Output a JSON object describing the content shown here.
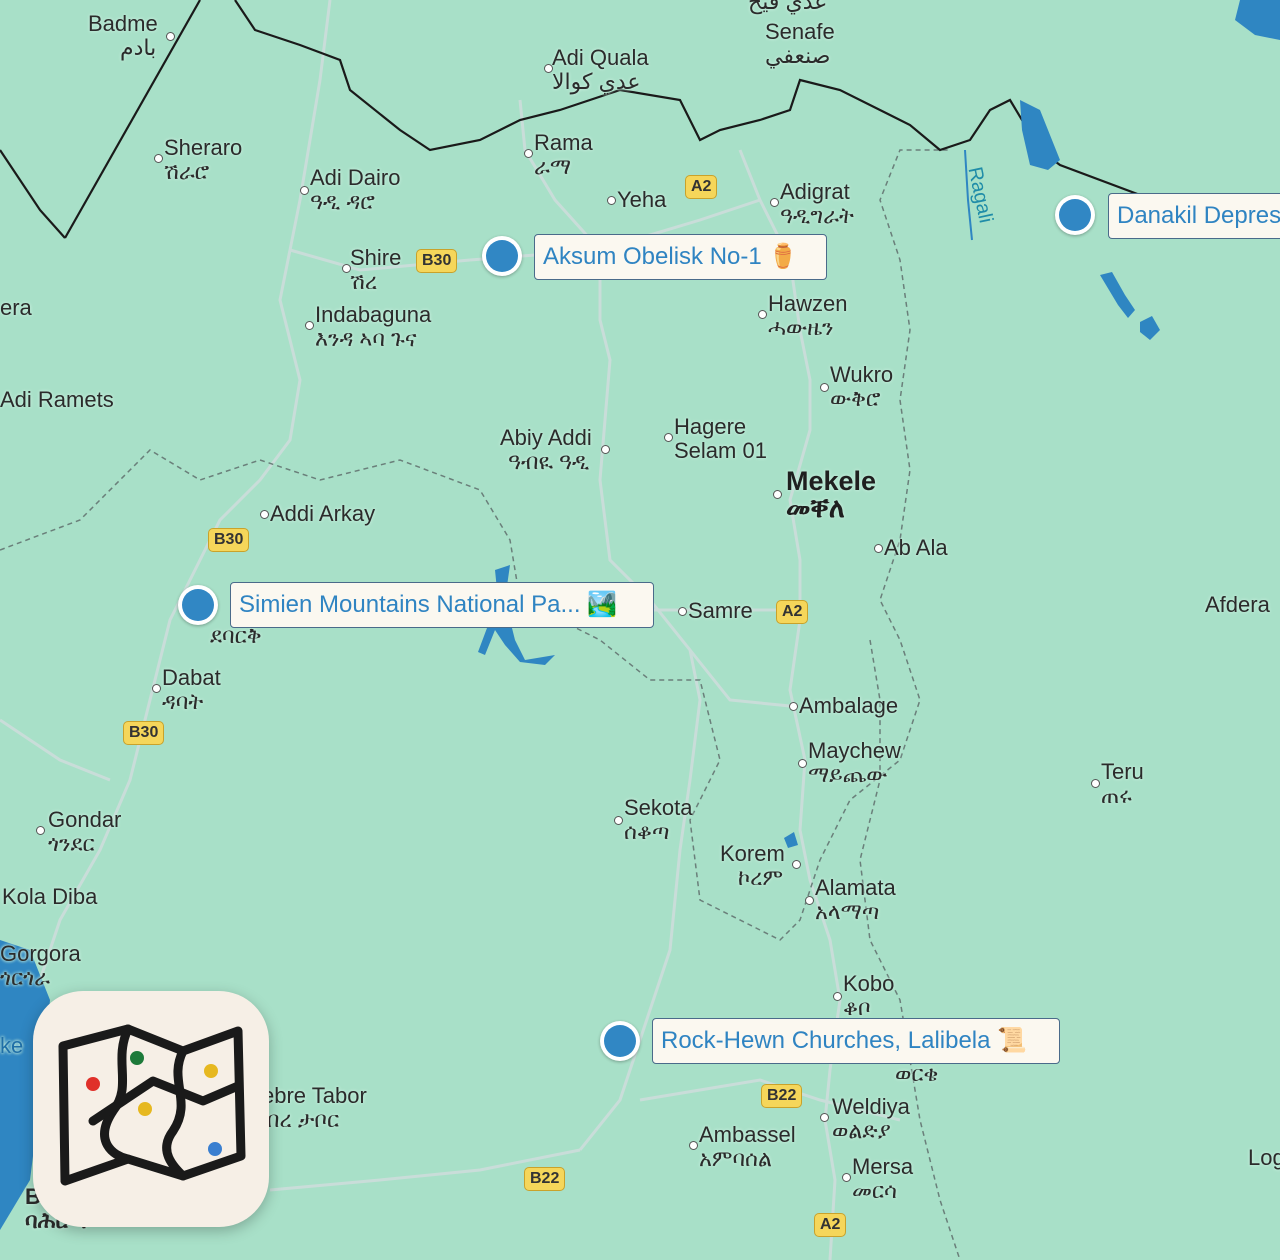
{
  "colors": {
    "land": "#a8e0c8",
    "water": "#2f86c2",
    "road": "#c9ddd9",
    "border": "#1a1a1a",
    "admin_border": "#6a7f7a",
    "poi_marker": "#3187c4",
    "poi_text": "#2f84c2",
    "road_badge": "#f5d65a"
  },
  "places": {
    "badme": {
      "en": "Badme",
      "local": "بادم"
    },
    "senafe": {
      "en": "Senafe",
      "local": "صنعفي"
    },
    "senafe_above": {
      "local": "عدي قيح"
    },
    "adi_quala": {
      "en": "Adi Quala",
      "local": "عدي كوالا"
    },
    "rama": {
      "en": "Rama",
      "local": "ራማ"
    },
    "sheraro": {
      "en": "Sheraro",
      "local": "ሽራሮ"
    },
    "adi_dairo": {
      "en": "Adi Dairo",
      "local": "ዓዲ ዳሮ"
    },
    "yeha": {
      "en": "Yeha"
    },
    "adigrat": {
      "en": "Adigrat",
      "local": "ዓዲግራት"
    },
    "shire": {
      "en": "Shire",
      "local": "ሽረ"
    },
    "indabaguna": {
      "en": "Indabaguna",
      "local": "እንዳ ኣባ ጉና"
    },
    "hawzen": {
      "en": "Hawzen",
      "local": "ሓውዜን"
    },
    "era": {
      "en": "era"
    },
    "wukro": {
      "en": "Wukro",
      "local": "ውቅሮ"
    },
    "adi_ramets": {
      "en": "Adi Ramets"
    },
    "abiy_addi": {
      "en": "Abiy Addi",
      "local": "ዓብዪ ዓዲ"
    },
    "hagere_selam": {
      "en": "Hagere",
      "en2": "Selam 01"
    },
    "mekele": {
      "en": "Mekele",
      "local": "መቐለ"
    },
    "addi_arkay": {
      "en": "Addi Arkay"
    },
    "ab_ala": {
      "en": "Ab Ala"
    },
    "samre": {
      "en": "Samre"
    },
    "afdera": {
      "en": "Afdera"
    },
    "debark_local": {
      "local": "ደባርቅ"
    },
    "dabat": {
      "en": "Dabat",
      "local": "ዳባት"
    },
    "ambalage": {
      "en": "Ambalage"
    },
    "maychew": {
      "en": "Maychew",
      "local": "ማይጨው"
    },
    "teru": {
      "en": "Teru",
      "local": "ጠሩ"
    },
    "gondar": {
      "en": "Gondar",
      "local": "ጎንደር"
    },
    "sekota": {
      "en": "Sekota",
      "local": "ሰቆጣ"
    },
    "korem": {
      "en": "Korem",
      "local": "ኮረም"
    },
    "alamata": {
      "en": "Alamata",
      "local": "አላማጣ"
    },
    "kola_diba": {
      "en": "Kola Diba"
    },
    "gorgora": {
      "en": "Gorgora",
      "local": "ጎርጎራ"
    },
    "kobo": {
      "en": "Kobo",
      "local": "ቆቦ"
    },
    "woldia_local": {
      "local": "ወርቄ"
    },
    "debre_tabor": {
      "en": "ebre Tabor",
      "local": "ብረ ታቦር"
    },
    "weldiya": {
      "en": "Weldiya",
      "local": "ወልድያ"
    },
    "ambassel": {
      "en": "Ambassel",
      "local": "አምባሰል"
    },
    "mersa": {
      "en": "Mersa",
      "local": "መርሳ"
    },
    "log": {
      "en": "Log"
    },
    "ke": {
      "en": "ke"
    },
    "bahir_local": {
      "local": "ባሕር ዳ"
    },
    "bahir_en": {
      "en": "B"
    }
  },
  "roads": {
    "a2_north": "A2",
    "a2_mid": "A2",
    "a2_south": "A2",
    "b30_shire": "B30",
    "b30_addi": "B30",
    "b30_dabat": "B30",
    "b22_lalibela": "B22",
    "b22_south": "B22"
  },
  "river": {
    "name": "Ragali"
  },
  "pois": [
    {
      "name": "Aksum Obelisk No-1",
      "emoji": "⚱️"
    },
    {
      "name": "Danakil Depres"
    },
    {
      "name": "Simien Mountains National Pa...",
      "emoji": "🏞️"
    },
    {
      "name": "Rock-Hewn Churches, Lalibela",
      "emoji": "📜"
    }
  ],
  "app": {
    "icon": "folded-map-icon",
    "pin_colors": [
      "#e0302a",
      "#1d7a3a",
      "#e6b820",
      "#e6b820",
      "#3a7fd0"
    ]
  }
}
